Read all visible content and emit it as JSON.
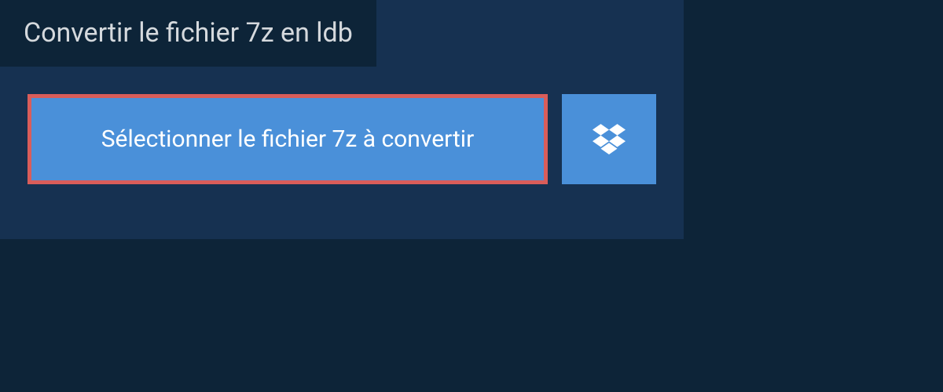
{
  "title": "Convertir le fichier 7z en ldb",
  "buttons": {
    "select_file_label": "Sélectionner le fichier 7z à convertir"
  },
  "colors": {
    "background": "#0d2438",
    "panel": "#163151",
    "button_primary": "#4a90d9",
    "highlight_border": "#d95d5a",
    "text_light": "#ffffff",
    "text_muted": "#d5d9dd"
  }
}
